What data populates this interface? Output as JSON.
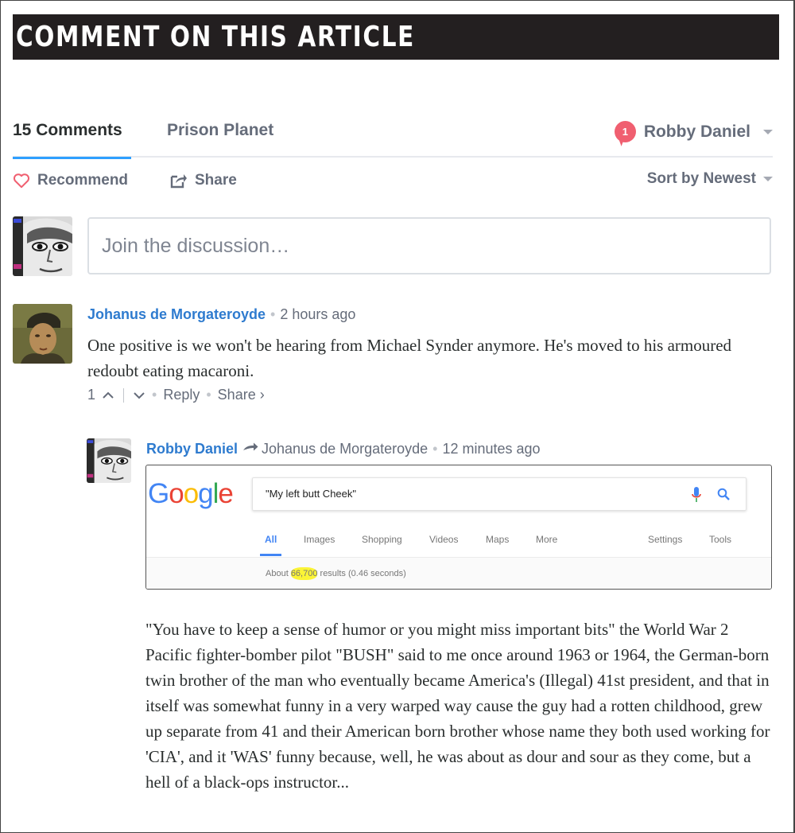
{
  "banner": {
    "title": "COMMENT ON THIS ARTICLE"
  },
  "tabs": {
    "comments": "15 Comments",
    "site": "Prison Planet",
    "notification_count": "1",
    "user_name": "Robby Daniel"
  },
  "actions": {
    "recommend": "Recommend",
    "share": "Share",
    "sort": "Sort by Newest"
  },
  "composer": {
    "placeholder": "Join the discussion…"
  },
  "comments": [
    {
      "author": "Johanus de Morgateroyde",
      "time": "2 hours ago",
      "body": "One positive is we won't be hearing from Michael Synder anymore. He's moved to his armoured redoubt eating macaroni.",
      "votes": "1",
      "reply": "Reply",
      "share": "Share ›"
    },
    {
      "author": "Robby Daniel",
      "in_reply_to": "Johanus de Morgateroyde",
      "time": "12 minutes ago",
      "screenshot": {
        "logo": "Google",
        "query": "\"My left butt Cheek\"",
        "tabs": [
          "All",
          "Images",
          "Shopping",
          "Videos",
          "Maps",
          "More"
        ],
        "settings": "Settings",
        "tools": "Tools",
        "stats_prefix": "About",
        "stats_count": "66,700",
        "stats_suffix": "results (0.46 seconds)"
      },
      "body": "\"You have to keep a sense of humor or you might miss important bits\" the World War 2 Pacific fighter-bomber pilot \"BUSH\" said to me once around 1963 or 1964, the German-born twin brother of the man who eventually became America's (Illegal) 41st president, and that in itself was somewhat funny in a very warped way cause the guy had a rotten childhood, grew up separate from 41 and their American born brother whose name they both used working for 'CIA', and it 'WAS' funny because, well, he was about as dour and sour as they come, but a hell of a black-ops instructor..."
    }
  ],
  "colors": {
    "banner": "#231f20",
    "link": "#2e7bcf",
    "tab_underline": "#2e9fff",
    "badge": "#f05f70",
    "highlight": "#fbf436"
  }
}
